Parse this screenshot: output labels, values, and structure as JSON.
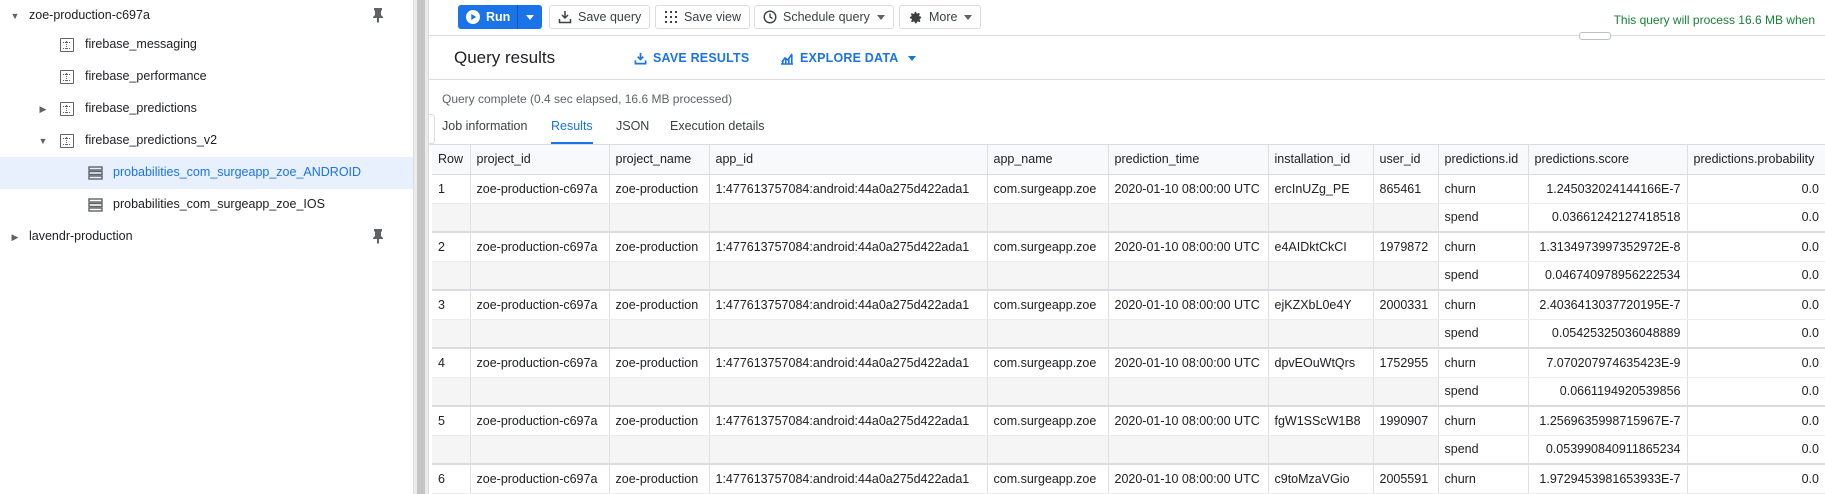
{
  "sidebar": {
    "items": [
      {
        "label": "zoe-production-c697a",
        "icon": "chevron-down-icon",
        "kind": "project"
      },
      {
        "label": "firebase_messaging",
        "icon": "dataset-icon",
        "kind": "dataset"
      },
      {
        "label": "firebase_performance",
        "icon": "dataset-icon",
        "kind": "dataset"
      },
      {
        "label": "firebase_predictions",
        "icon": "dataset-icon",
        "kind": "dataset"
      },
      {
        "label": "firebase_predictions_v2",
        "icon": "dataset-icon",
        "kind": "dataset"
      },
      {
        "label": "probabilities_com_surgeapp_zoe_ANDROID",
        "icon": "table-icon",
        "kind": "table",
        "selected": true
      },
      {
        "label": "probabilities_com_surgeapp_zoe_IOS",
        "icon": "table-icon",
        "kind": "table"
      },
      {
        "label": "lavendr-production",
        "icon": "chevron-right-icon",
        "kind": "project"
      }
    ]
  },
  "toolbar": {
    "run_label": "Run",
    "save_query_label": "Save query",
    "save_view_label": "Save view",
    "schedule_label": "Schedule query",
    "more_label": "More",
    "process_note": "This query will process 16.6 MB when"
  },
  "results": {
    "title": "Query results",
    "save_results": "SAVE RESULTS",
    "explore_data": "EXPLORE DATA",
    "status": "Query complete (0.4 sec elapsed, 16.6 MB processed)"
  },
  "tabs": [
    "Job information",
    "Results",
    "JSON",
    "Execution details"
  ],
  "active_tab": "Results",
  "table": {
    "columns": [
      "Row",
      "project_id",
      "project_name",
      "app_id",
      "app_name",
      "prediction_time",
      "installation_id",
      "user_id",
      "predictions.id",
      "predictions.score",
      "predictions.probability"
    ],
    "rows": [
      {
        "row": "1",
        "project_id": "zoe-production-c697a",
        "project_name": "zoe-production",
        "app_id": "1:477613757084:android:44a0a275d422ada1",
        "app_name": "com.surgeapp.zoe",
        "prediction_time": "2020-01-10 08:00:00 UTC",
        "installation_id": "ercInUZg_PE",
        "user_id": "865461",
        "predictions": [
          {
            "id": "churn",
            "score": "1.245032024144166E-7",
            "probability": "0.0"
          },
          {
            "id": "spend",
            "score": "0.03661242127418518",
            "probability": "0.0"
          }
        ]
      },
      {
        "row": "2",
        "project_id": "zoe-production-c697a",
        "project_name": "zoe-production",
        "app_id": "1:477613757084:android:44a0a275d422ada1",
        "app_name": "com.surgeapp.zoe",
        "prediction_time": "2020-01-10 08:00:00 UTC",
        "installation_id": "e4AIDktCkCI",
        "user_id": "1979872",
        "predictions": [
          {
            "id": "churn",
            "score": "1.3134973997352972E-8",
            "probability": "0.0"
          },
          {
            "id": "spend",
            "score": "0.046740978956222534",
            "probability": "0.0"
          }
        ]
      },
      {
        "row": "3",
        "project_id": "zoe-production-c697a",
        "project_name": "zoe-production",
        "app_id": "1:477613757084:android:44a0a275d422ada1",
        "app_name": "com.surgeapp.zoe",
        "prediction_time": "2020-01-10 08:00:00 UTC",
        "installation_id": "ejKZXbL0e4Y",
        "user_id": "2000331",
        "predictions": [
          {
            "id": "churn",
            "score": "2.4036413037720195E-7",
            "probability": "0.0"
          },
          {
            "id": "spend",
            "score": "0.05425325036048889",
            "probability": "0.0"
          }
        ]
      },
      {
        "row": "4",
        "project_id": "zoe-production-c697a",
        "project_name": "zoe-production",
        "app_id": "1:477613757084:android:44a0a275d422ada1",
        "app_name": "com.surgeapp.zoe",
        "prediction_time": "2020-01-10 08:00:00 UTC",
        "installation_id": "dpvEOuWtQrs",
        "user_id": "1752955",
        "predictions": [
          {
            "id": "churn",
            "score": "7.070207974635423E-9",
            "probability": "0.0"
          },
          {
            "id": "spend",
            "score": "0.0661194920539856",
            "probability": "0.0"
          }
        ]
      },
      {
        "row": "5",
        "project_id": "zoe-production-c697a",
        "project_name": "zoe-production",
        "app_id": "1:477613757084:android:44a0a275d422ada1",
        "app_name": "com.surgeapp.zoe",
        "prediction_time": "2020-01-10 08:00:00 UTC",
        "installation_id": "fgW1SScW1B8",
        "user_id": "1990907",
        "predictions": [
          {
            "id": "churn",
            "score": "1.2569635998715967E-7",
            "probability": "0.0"
          },
          {
            "id": "spend",
            "score": "0.053990840911865234",
            "probability": "0.0"
          }
        ]
      },
      {
        "row": "6",
        "project_id": "zoe-production-c697a",
        "project_name": "zoe-production",
        "app_id": "1:477613757084:android:44a0a275d422ada1",
        "app_name": "com.surgeapp.zoe",
        "prediction_time": "2020-01-10 08:00:00 UTC",
        "installation_id": "c9toMzaVGio",
        "user_id": "2005591",
        "predictions": [
          {
            "id": "churn",
            "score": "1.9729453981653933E-7",
            "probability": "0.0"
          }
        ]
      }
    ]
  },
  "colors": {
    "accent": "#1a73e8",
    "selected_bg": "#e8f0fe",
    "success": "#188038"
  }
}
